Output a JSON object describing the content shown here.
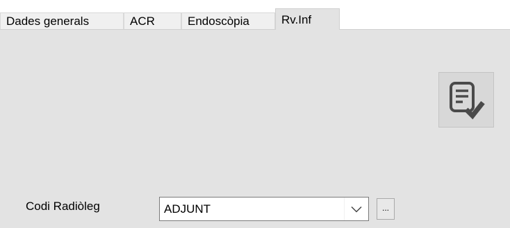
{
  "tabs": [
    {
      "label": "Dades generals",
      "active": false
    },
    {
      "label": "ACR",
      "active": false
    },
    {
      "label": "Endoscòpia",
      "active": false
    },
    {
      "label": "Rv.Inf",
      "active": true
    }
  ],
  "form": {
    "radiologist_label": "Codi Radiòleg",
    "radiologist_value": "ADJUNT",
    "browse_label": "..."
  },
  "icons": {
    "report_button": "report-check-icon",
    "combo_arrow": "chevron-down-icon"
  },
  "colors": {
    "panel": "#e3e3e3",
    "icon": "#4a4a4a"
  }
}
